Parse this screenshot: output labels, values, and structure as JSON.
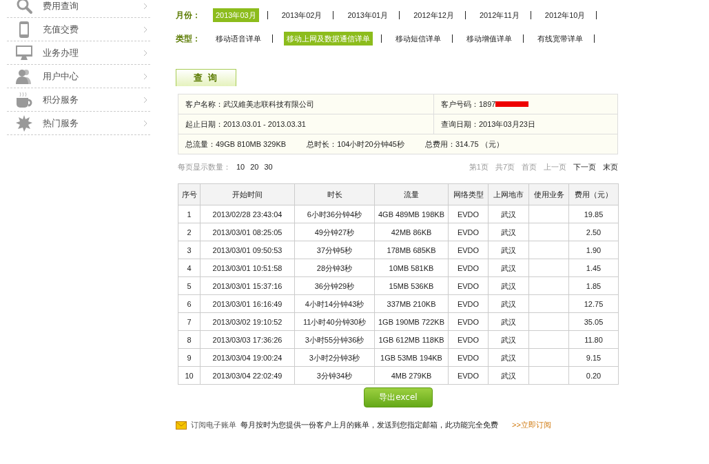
{
  "sidebar": {
    "items": [
      {
        "label": "费用查询"
      },
      {
        "label": "充值交费"
      },
      {
        "label": "业务办理"
      },
      {
        "label": "用户中心"
      },
      {
        "label": "积分服务"
      },
      {
        "label": "热门服务"
      }
    ]
  },
  "filters": {
    "month_label": "月份：",
    "months": [
      {
        "label": "2013年03月",
        "selected": true
      },
      {
        "label": "2013年02月",
        "selected": false
      },
      {
        "label": "2013年01月",
        "selected": false
      },
      {
        "label": "2012年12月",
        "selected": false
      },
      {
        "label": "2012年11月",
        "selected": false
      },
      {
        "label": "2012年10月",
        "selected": false
      }
    ],
    "type_label": "类型：",
    "types": [
      {
        "label": "移动语音详单",
        "selected": false
      },
      {
        "label": "移动上网及数据通信详单",
        "selected": true
      },
      {
        "label": "移动短信详单",
        "selected": false
      },
      {
        "label": "移动增值详单",
        "selected": false
      },
      {
        "label": "有线宽带详单",
        "selected": false
      }
    ]
  },
  "query_tab": "查 询",
  "summary": {
    "customer_name": "客户名称：武汉維美志联科技有限公司",
    "customer_number": "客户号码：1897",
    "customer_number_redacted": true,
    "period": "起止日期：2013.03.01 - 2013.03.31",
    "query_date": "查询日期：2013年03月23日",
    "total_traffic": "总流量：49GB 810MB 329KB",
    "total_duration": "总时长：104小时20分钟45秒",
    "total_fee": "总费用：314.75 （元）"
  },
  "page_size": {
    "label": "每页显示数量：",
    "options": [
      "10",
      "20",
      "30"
    ]
  },
  "pagination": [
    {
      "label": "第1页",
      "disabled": true
    },
    {
      "label": "共7页",
      "disabled": true
    },
    {
      "label": "首页",
      "disabled": true
    },
    {
      "label": "上一页",
      "disabled": true
    },
    {
      "label": "下一页",
      "disabled": false
    },
    {
      "label": "末页",
      "disabled": false
    }
  ],
  "table": {
    "columns": [
      "序号",
      "开始时间",
      "时长",
      "流量",
      "网络类型",
      "上网地市",
      "使用业务",
      "费用（元）"
    ],
    "rows": [
      [
        "1",
        "2013/02/28 23:43:04",
        "6小时36分钟4秒",
        "4GB 489MB 198KB",
        "EVDO",
        "武汉",
        "",
        "19.85"
      ],
      [
        "2",
        "2013/03/01 08:25:05",
        "49分钟27秒",
        "42MB 86KB",
        "EVDO",
        "武汉",
        "",
        "2.50"
      ],
      [
        "3",
        "2013/03/01 09:50:53",
        "37分钟5秒",
        "178MB 685KB",
        "EVDO",
        "武汉",
        "",
        "1.90"
      ],
      [
        "4",
        "2013/03/01 10:51:58",
        "28分钟3秒",
        "10MB 581KB",
        "EVDO",
        "武汉",
        "",
        "1.45"
      ],
      [
        "5",
        "2013/03/01 15:37:16",
        "36分钟29秒",
        "15MB 536KB",
        "EVDO",
        "武汉",
        "",
        "1.85"
      ],
      [
        "6",
        "2013/03/01 16:16:49",
        "4小时14分钟43秒",
        "337MB 210KB",
        "EVDO",
        "武汉",
        "",
        "12.75"
      ],
      [
        "7",
        "2013/03/02 19:10:52",
        "11小时40分钟30秒",
        "1GB 190MB 722KB",
        "EVDO",
        "武汉",
        "",
        "35.05"
      ],
      [
        "8",
        "2013/03/03 17:36:26",
        "3小时55分钟36秒",
        "1GB 612MB 118KB",
        "EVDO",
        "武汉",
        "",
        "11.80"
      ],
      [
        "9",
        "2013/03/04 19:00:24",
        "3小时2分钟3秒",
        "1GB 53MB 194KB",
        "EVDO",
        "武汉",
        "",
        "9.15"
      ],
      [
        "10",
        "2013/03/04 22:02:49",
        "3分钟34秒",
        "4MB 279KB",
        "EVDO",
        "武汉",
        "",
        "0.20"
      ]
    ]
  },
  "export_button": "导出excel",
  "subscribe": {
    "title": "订阅电子账单",
    "text": "每月按时为您提供一份客户上月的账单，发送到您指定邮箱，此功能完全免费",
    "link": ">>立即订阅"
  }
}
